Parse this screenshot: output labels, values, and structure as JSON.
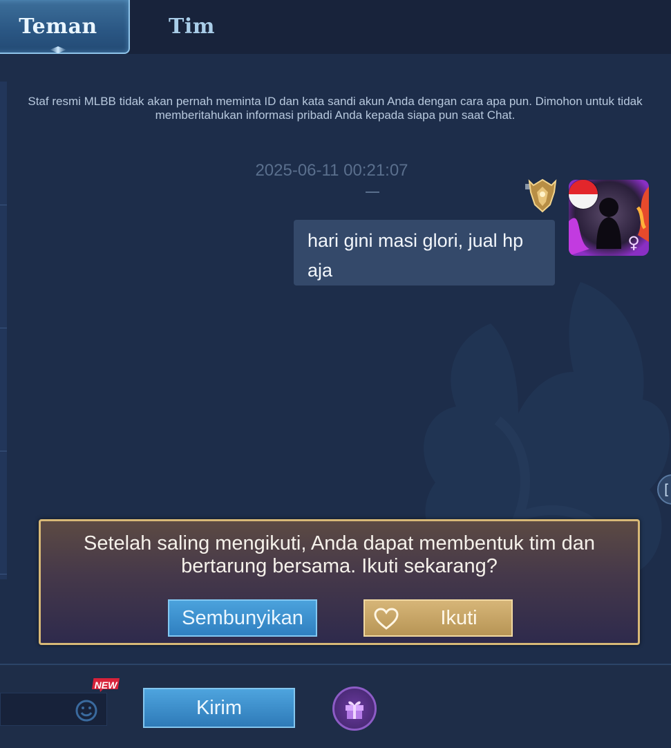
{
  "tabs": [
    {
      "label": "Teman",
      "active": true
    },
    {
      "label": "Tim",
      "active": false
    }
  ],
  "chat": {
    "notice": "Staf resmi MLBB tidak akan pernah meminta ID dan kata sandi akun Anda dengan cara apa pun. Dimohon untuk tidak memberitahukan informasi pribadi Anda kepada siapa pun saat Chat.",
    "timestamp": "2025-06-11 00:21:07",
    "message": {
      "text": "hari gini masi glori, jual hp aja",
      "gender_symbol": "♀",
      "flag": "Indonesia"
    }
  },
  "follow_prompt": {
    "text": "Setelah saling mengikuti, Anda dapat membentuk tim dan bertarung bersama. Ikuti sekarang?",
    "hide_label": "Sembunyikan",
    "follow_label": "Ikuti"
  },
  "input_bar": {
    "new_badge": "NEW",
    "send_label": "Kirim"
  },
  "icons": {
    "rank": "rank-badge-icon",
    "emoji": "emoji-icon",
    "gift": "gift-icon",
    "heart": "heart-icon",
    "side": "expand-icon"
  },
  "colors": {
    "background": "#1d2d4a",
    "accent_blue": "#2f7fc0",
    "accent_gold": "#d8b977",
    "badge_red": "#d8223a"
  }
}
